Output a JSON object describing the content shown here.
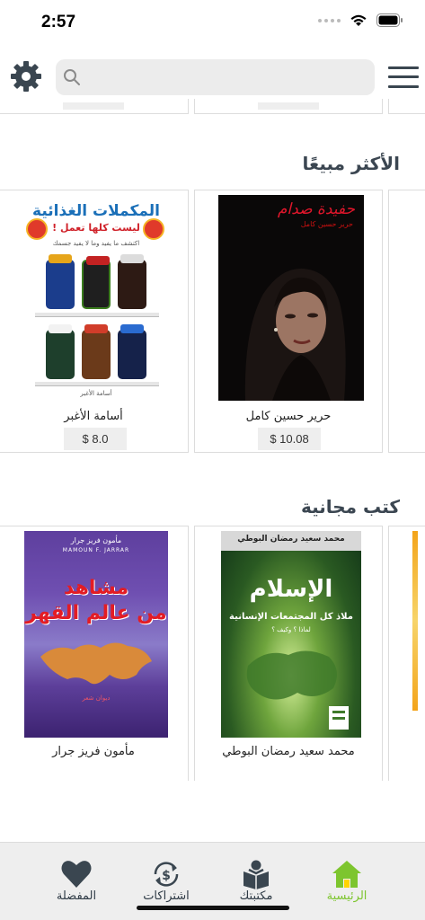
{
  "status_bar": {
    "time": "2:57"
  },
  "search": {
    "placeholder": "",
    "value": ""
  },
  "sections": [
    {
      "title": "الأكثر مبيعًا",
      "books": [
        {
          "author": "حرير حسين كامل",
          "price": "$ 10.08",
          "cover": {
            "title": "حفيدة صدام",
            "subtitle": "حرير حسين كامل"
          }
        },
        {
          "author": "أسامة الأغبر",
          "price": "$ 8.0",
          "cover": {
            "title": "المكملات الغذائية",
            "line2": "ليست كلها تعمل !",
            "line3": "اكتشف ما يفيد وما لا يفيد جسمك",
            "author": "أسامة الأغبر"
          }
        }
      ]
    },
    {
      "title": "كتب مجانية",
      "books": [
        {
          "author": "محمد سعيد رمضان البوطي",
          "cover": {
            "header": "محمد سعيد رمضان البوطي",
            "title": "الإسلام",
            "subtitle": "ملاذ كل المجتمعات الإنسانية",
            "line3": "لماذا ؟ وكيف ؟"
          }
        },
        {
          "author": "مأمون فريز جرار",
          "cover": {
            "top_ar": "مأمون فريز جرار",
            "top_en": "MAMOUN F. JARRAR",
            "title_line1": "مشاهد",
            "title_line2": "من عالم القهر",
            "small": "ديوان شعر"
          }
        }
      ]
    }
  ],
  "tab_bar": {
    "tabs": [
      {
        "label": "الرئيسية",
        "icon": "home-icon",
        "active": true
      },
      {
        "label": "مكتبتك",
        "icon": "library-icon",
        "active": false
      },
      {
        "label": "اشتراكات",
        "icon": "subscriptions-icon",
        "active": false
      },
      {
        "label": "المفضلة",
        "icon": "heart-icon",
        "active": false
      }
    ]
  },
  "colors": {
    "accent": "#7dc52e",
    "icon": "#3a4650",
    "title": "#3b4651"
  }
}
